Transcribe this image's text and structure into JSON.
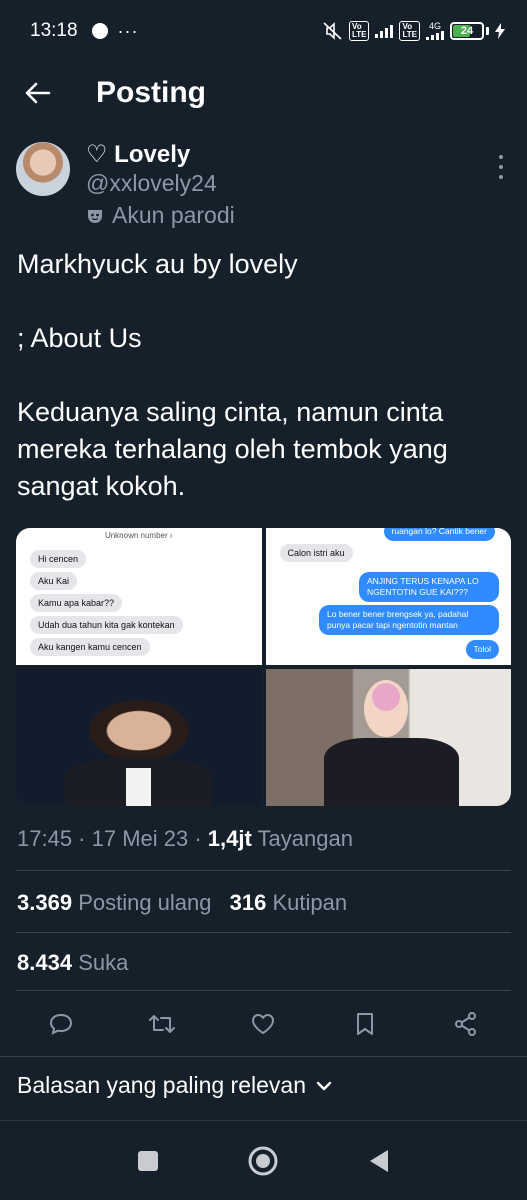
{
  "status_bar": {
    "time": "13:18",
    "more": "···",
    "network": "4G",
    "battery": "24"
  },
  "header": {
    "title": "Posting"
  },
  "author": {
    "name": "♡ Lovely",
    "handle": "@xxlovely24",
    "badge": "Akun parodi"
  },
  "tweet": {
    "paragraphs": [
      "Markhyuck au by lovely",
      "; About Us",
      "Keduanya saling cinta, namun cinta mereka terhalang oleh tembok yang sangat kokoh."
    ]
  },
  "media": {
    "chat_left": {
      "header": "Unknown number  ›",
      "messages": [
        "Hi cencen",
        "Aku Kai",
        "Kamu apa kabar??",
        "Udah dua tahun kita gak kontekan",
        "Aku kangen kamu cencen"
      ]
    },
    "chat_right": {
      "top_cut": "ruangan lo? Cantik bener",
      "left_msg": "Calon istri aku",
      "right_msgs": [
        "ANJING TERUS KENAPA LO NGENTOTIN GUE KAI???",
        "Lo bener bener brengsek ya, padahal punya pacar tapi ngentotin mantan",
        "Tolol"
      ]
    }
  },
  "meta": {
    "time": "17:45 · 17 Mei 23 · ",
    "views_count": "1,4jt",
    "views_label": " Tayangan"
  },
  "stats": {
    "reposts_count": "3.369",
    "reposts_label": "Posting ulang",
    "quotes_count": "316",
    "quotes_label": "Kutipan",
    "likes_count": "8.434",
    "likes_label": "Suka"
  },
  "replies_sort": {
    "label": "Balasan yang paling relevan"
  },
  "colors": {
    "background": "#15202b",
    "secondary_text": "#8b98a5",
    "divider": "#38444d",
    "bubble_blue": "#2f8bff"
  }
}
